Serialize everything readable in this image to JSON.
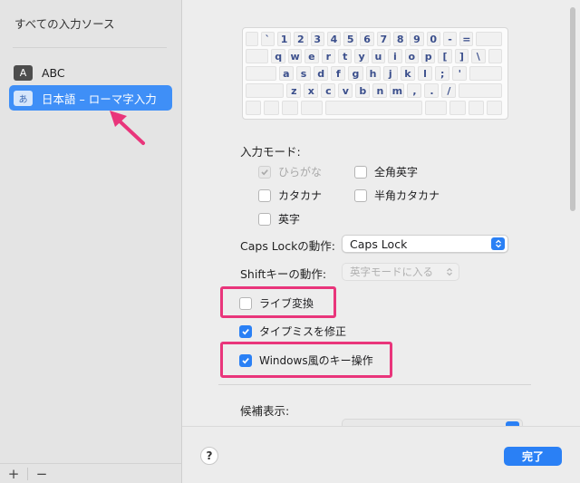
{
  "sidebar": {
    "title": "すべての入力ソース",
    "items": [
      {
        "badge": "A",
        "label": "ABC"
      },
      {
        "badge": "あ",
        "label": "日本語 – ローマ字入力"
      }
    ],
    "add_label": "+",
    "remove_label": "−"
  },
  "keyboard": {
    "rows": [
      [
        "`",
        "1",
        "2",
        "3",
        "4",
        "5",
        "6",
        "7",
        "8",
        "9",
        "0",
        "-",
        "="
      ],
      [
        "q",
        "w",
        "e",
        "r",
        "t",
        "y",
        "u",
        "i",
        "o",
        "p",
        "[",
        "]",
        "\\"
      ],
      [
        "a",
        "s",
        "d",
        "f",
        "g",
        "h",
        "j",
        "k",
        "l",
        ";",
        "'"
      ],
      [
        "z",
        "x",
        "c",
        "v",
        "b",
        "n",
        "m",
        ",",
        ".",
        "/"
      ]
    ]
  },
  "input_mode": {
    "label": "入力モード:",
    "options": [
      {
        "label": "ひらがな",
        "checked": true,
        "disabled": true
      },
      {
        "label": "全角英字",
        "checked": false
      },
      {
        "label": "カタカナ",
        "checked": false
      },
      {
        "label": "半角カタカナ",
        "checked": false
      },
      {
        "label": "英字",
        "checked": false
      }
    ]
  },
  "caps_lock": {
    "label": "Caps Lockの動作:",
    "value": "Caps Lock"
  },
  "shift": {
    "label": "Shiftキーの動作:",
    "value": "英字モードに入る"
  },
  "live_conversion": {
    "label": "ライブ変換",
    "checked": false
  },
  "typo_fix": {
    "label": "タイプミスを修正",
    "checked": true
  },
  "windows_keys": {
    "label": "Windows風のキー操作",
    "checked": true
  },
  "candidates": {
    "label": "候補表示:"
  },
  "footer": {
    "help_label": "?",
    "done_label": "完了"
  },
  "colors": {
    "accent": "#2a80f5",
    "highlight": "#e9357b",
    "selection": "#3f8ff7"
  }
}
